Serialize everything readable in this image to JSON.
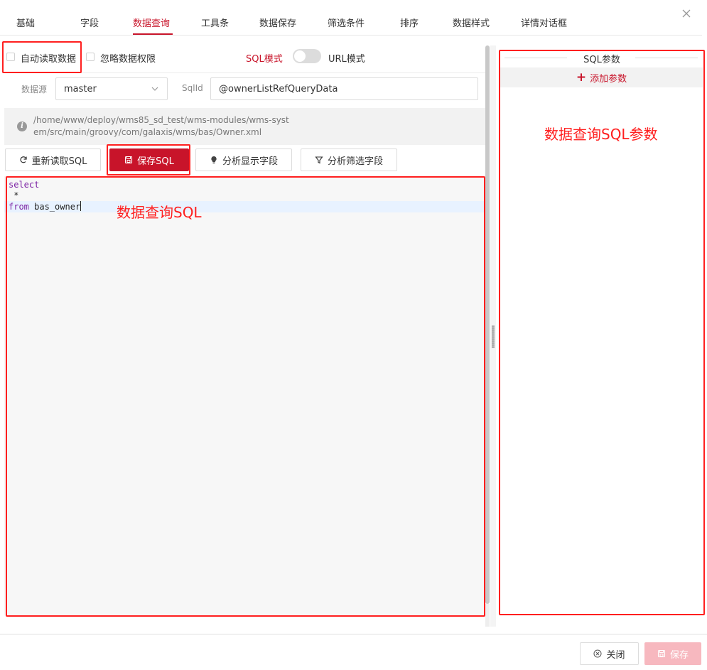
{
  "tabs": [
    {
      "label": "基础"
    },
    {
      "label": "字段"
    },
    {
      "label": "数据查询"
    },
    {
      "label": "工具条"
    },
    {
      "label": "数据保存"
    },
    {
      "label": "筛选条件"
    },
    {
      "label": "排序"
    },
    {
      "label": "数据样式"
    },
    {
      "label": "详情对话框"
    }
  ],
  "active_tab": "数据查询",
  "options": {
    "auto_read_label": "自动读取数据",
    "ignore_permission_label": "忽略数据权限",
    "sql_mode_label": "SQL模式",
    "url_mode_label": "URL模式"
  },
  "form": {
    "datasource_label": "数据源",
    "datasource_value": "master",
    "sqlid_label": "SqlId",
    "sqlid_value": "@ownerListRefQueryData"
  },
  "file_path": "/home/www/deploy/wms85_sd_test/wms-modules/wms-system/src/main/groovy/com/galaxis/wms/bas/Owner.xml",
  "toolbar": {
    "reload_sql": "重新读取SQL",
    "save_sql": "保存SQL",
    "analyze_display": "分析显示字段",
    "analyze_filter": "分析筛选字段"
  },
  "editor": {
    "line1_kw": "select",
    "line2": " *",
    "line3_kw": "from",
    "line3_rest": " bas_owner"
  },
  "params": {
    "title": "SQL参数",
    "add_label": "添加参数"
  },
  "annotations": {
    "query_sql": "数据查询SQL",
    "query_sql_params": "数据查询SQL参数"
  },
  "footer": {
    "close_label": "关闭",
    "save_label": "保存"
  },
  "colors": {
    "accent": "#c8142a",
    "annotation": "#ff1f1f"
  }
}
